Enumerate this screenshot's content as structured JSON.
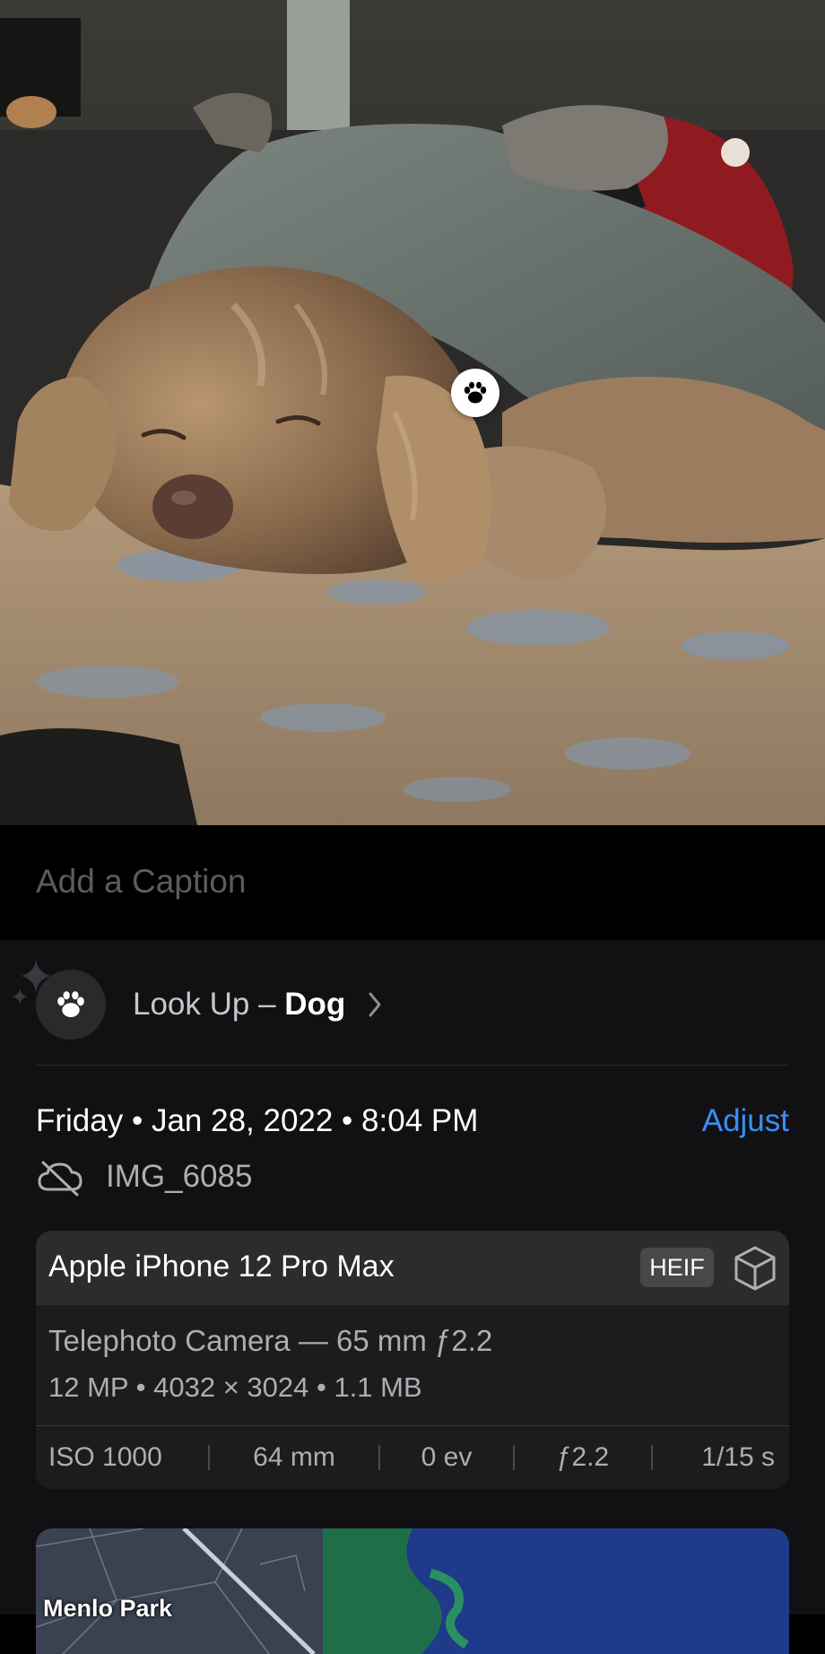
{
  "photo": {
    "subject_icon": "paw-icon"
  },
  "caption": {
    "placeholder": "Add a Caption",
    "value": ""
  },
  "lookup": {
    "prefix": "Look Up – ",
    "subject": "Dog",
    "icon": "paw-icon",
    "chevron": "chevron-right-icon"
  },
  "info": {
    "date_line": "Friday • Jan 28, 2022 • 8:04 PM",
    "adjust_label": "Adjust",
    "file_name": "IMG_6085",
    "cloud_icon": "cloud-slash-icon"
  },
  "camera": {
    "device": "Apple iPhone 12 Pro Max",
    "format_badge": "HEIF",
    "lens": "Telephoto Camera — 65 mm ƒ2.2",
    "specs": "12 MP  •  4032 × 3024  •  1.1 MB",
    "exif": [
      "ISO 1000",
      "64 mm",
      "0 ev",
      "ƒ2.2",
      "1/15 s"
    ]
  },
  "map": {
    "place_label": "Menlo Park"
  },
  "colors": {
    "accent": "#3a8ef6",
    "background": "#000000",
    "sheet": "#111113",
    "card": "#1c1c1e"
  }
}
